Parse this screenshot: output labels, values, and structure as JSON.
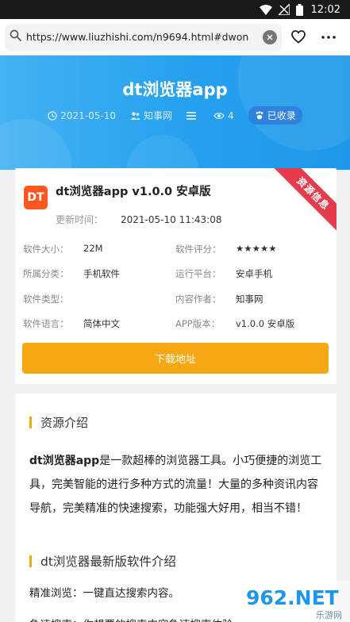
{
  "status": {
    "time": "12:02"
  },
  "browser": {
    "url": "https://www.liuzhishi.com/n9694.html#dwon"
  },
  "hero": {
    "title": "dt浏览器app",
    "date": "2021-05-10",
    "site": "知事网",
    "views": "4",
    "indexed_badge": "已收录"
  },
  "app": {
    "logo_text": "DT",
    "name": "dt浏览器app v1.0.0 安卓版",
    "update_label": "更新时间：",
    "update_value": "2021-05-10 11:43:08",
    "ribbon": "资源信息",
    "fields": [
      {
        "k1": "软件大小：",
        "v1": "22M",
        "k2": "软件评分：",
        "v2": "★★★★★"
      },
      {
        "k1": "所属分类：",
        "v1": "手机软件",
        "k2": "运行平台：",
        "v2": "安卓手机"
      },
      {
        "k1": "软件类型：",
        "v1": "",
        "k2": "内容作者：",
        "v2": "知事网"
      },
      {
        "k1": "软件语言：",
        "v1": "简体中文",
        "k2": "APP版本：",
        "v2": "v1.0.0 安卓版"
      }
    ],
    "download_label": "下载地址"
  },
  "content": {
    "section1_title": "资源介绍",
    "intro_bold": "dt浏览器app",
    "intro_rest": "是一款超棒的浏览器工具。小巧便捷的浏览工具，完美智能的进行多种方式的流量！大量的多种资讯内容导航，完美精准的快速搜索，功能强大好用，相当不错！",
    "section2_title": "dt浏览器最新版软件介绍",
    "line1": "精准浏览：一键直达搜索内容。",
    "line2": "急速搜索：你想要的搜索内容急速搜索体验。"
  },
  "watermark": {
    "text": "962.NET",
    "sub": "乐游网"
  },
  "colors": {
    "hero": "#27a2ef",
    "accent": "#f5a814",
    "ribbon": "#e63b4c",
    "logo": "#ff5722"
  }
}
